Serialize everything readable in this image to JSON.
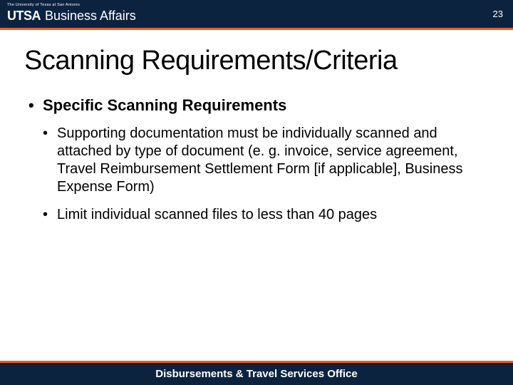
{
  "header": {
    "tagline": "The University of Texas at San Antonio",
    "logo": "UTSA",
    "department": "Business Affairs",
    "page_number": "23"
  },
  "slide": {
    "title": "Scanning Requirements/Criteria",
    "section_heading": "Specific Scanning Requirements",
    "bullets": [
      "Supporting documentation must be individually scanned and attached by type of document (e. g. invoice, service agreement, Travel Reimbursement Settlement Form [if applicable], Business Expense Form)",
      "Limit individual scanned files to less than 40 pages"
    ]
  },
  "footer": {
    "text": "Disbursements & Travel Services Office"
  }
}
